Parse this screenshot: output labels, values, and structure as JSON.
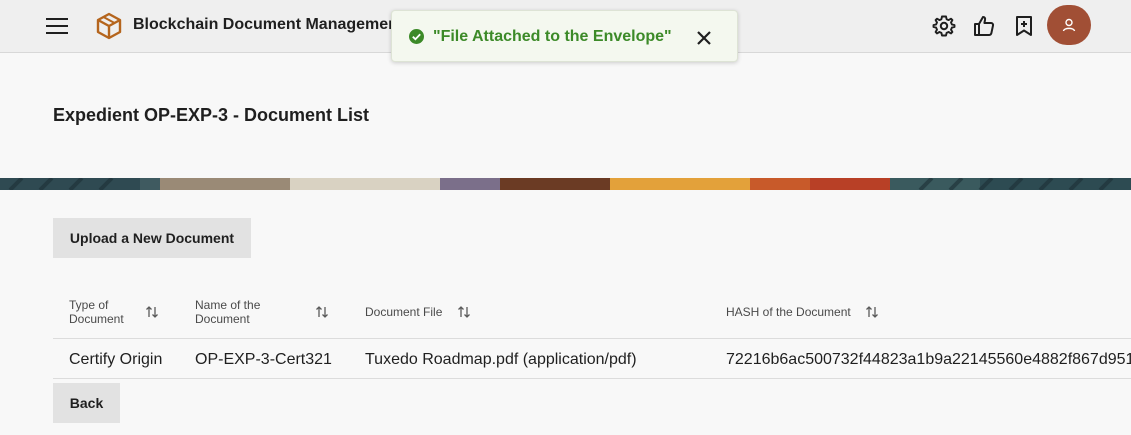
{
  "header": {
    "app_title": "Blockchain Document Management",
    "icons": [
      "menu-icon",
      "cube-logo-icon",
      "settings-icon",
      "thumbs-up-icon",
      "bookmark-icon",
      "user-icon"
    ]
  },
  "toast": {
    "message": "\"File Attached to the Envelope\"",
    "status_color": "#3c8a28"
  },
  "page": {
    "title": "Expedient OP-EXP-3 - Document List"
  },
  "actions": {
    "upload_label": "Upload a New Document",
    "back_label": "Back"
  },
  "table": {
    "columns": [
      "Type of Document",
      "Name of the Document",
      "Document File",
      "HASH of the Document"
    ],
    "rows": [
      {
        "type": "Certify Origin",
        "name": "OP-EXP-3-Cert321",
        "file": "Tuxedo Roadmap.pdf (application/pdf)",
        "hash": "72216b6ac500732f44823a1b9a22145560e4882f867d951"
      }
    ]
  },
  "colors": {
    "avatar": "#a14f35",
    "topbar": "#efefef",
    "button": "#e2e2e2"
  }
}
